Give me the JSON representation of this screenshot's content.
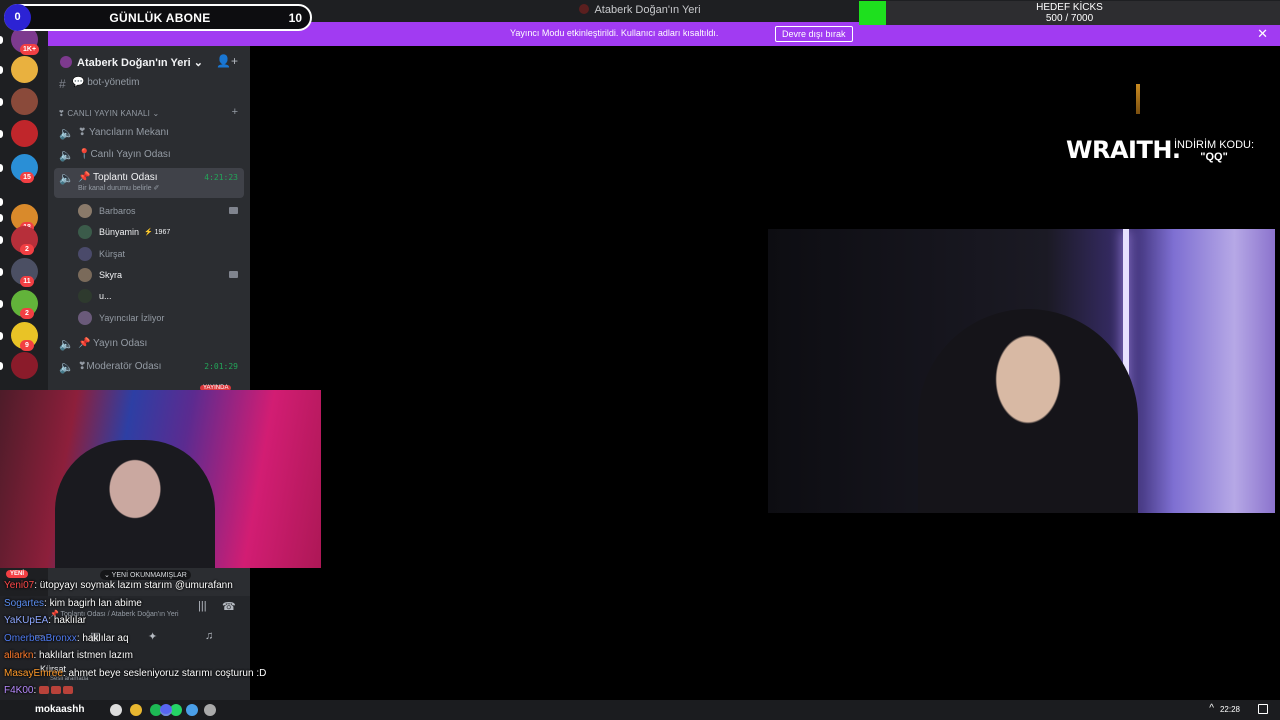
{
  "overlay": {
    "sub_counter": {
      "left_count": "0",
      "label": "GÜNLÜK ABONE",
      "right_count": "10"
    },
    "kicks_goal": {
      "title": "HEDEF KİCKS",
      "progress_text": "500 / 7000",
      "progress": 0.0714,
      "fill_color": "#1ee01e"
    },
    "sponsor": {
      "logo": "WRAITH.",
      "code_label": "İNDİRİM KODU:",
      "code": "\"QQ\""
    }
  },
  "window": {
    "title": "Ataberk Doğan'ın Yeri"
  },
  "banner": {
    "message": "Yayıncı Modu etkinleştirildi. Kullanıcı adları kısaltıldı.",
    "button": "Devre dışı bırak",
    "close": "✕",
    "color": "#a13bf2"
  },
  "rail": {
    "servers": [
      {
        "badge": "1K+",
        "color": "#7d3a8e"
      },
      {
        "badge": "",
        "color": "#e9b13f"
      },
      {
        "badge": "",
        "color": "#8a4a3a"
      },
      {
        "badge": "",
        "color": "#c0262b"
      },
      {
        "badge": "15",
        "color": "#2a8fd6"
      },
      {
        "badge": "",
        "color": "#3a3c45"
      },
      {
        "badge": "18",
        "color": "#d98a2b"
      },
      {
        "badge": "2",
        "color": "#b72f3a"
      },
      {
        "badge": "11",
        "color": "#4b4f63"
      },
      {
        "badge": "2",
        "color": "#62b33a"
      },
      {
        "badge": "9",
        "color": "#e9c326"
      },
      {
        "badge": "",
        "color": "#8a1b2a"
      }
    ]
  },
  "sidebar": {
    "server_name": "Ataberk Doğan'ın Yeri",
    "server_chevron": "⌄",
    "channels_top": [
      {
        "name": "💬 bot-yönetim",
        "icon": "#"
      }
    ],
    "category": {
      "name": "❣ CANLI YAYIN KANALI ⌄",
      "add": "+"
    },
    "voice_channels": [
      {
        "name": "❣ Yancıların Mekanı"
      },
      {
        "name": "📍Canlı Yayın Odası"
      }
    ],
    "active_channel": {
      "name": "📌 Toplantı Odası",
      "time": "4:21:23",
      "status": "Bir kanal durumu belirle ✐"
    },
    "members": [
      {
        "name": "Barbaros",
        "camera": true,
        "extra": ""
      },
      {
        "name": "Bünyamin",
        "camera": false,
        "extra": "⚡ 1967"
      },
      {
        "name": "Kürşat",
        "camera": false,
        "extra": ""
      },
      {
        "name": "Skyra",
        "camera": true,
        "extra": ""
      },
      {
        "name": "u...",
        "camera": false,
        "extra": ""
      },
      {
        "name": "Yayıncılar İzliyor",
        "camera": false,
        "extra": ""
      }
    ],
    "more_channels": [
      {
        "name": "📌 Yayın Odası",
        "time": ""
      },
      {
        "name": "❣Moderatör Odası",
        "time": "2:01:29"
      }
    ],
    "live_badge": "YAYINDA"
  },
  "stream_overlay": {
    "new_tag": "YENİ",
    "unread": "⌄ YENİ OKUNMAMIŞLAR"
  },
  "voice_panel": {
    "channel": "📌 Toplantı Odası / Ataberk Doğan'ın Yeri",
    "user": "Kürşat",
    "status": "Sesli aramada"
  },
  "chat": {
    "messages": [
      {
        "user": "Yeni07",
        "color": "#ff4a4a",
        "text": ": ütopyayı soymak lazım starım @umurafann"
      },
      {
        "user": "Sogartes",
        "color": "#5b8def",
        "text": ": kim bagirh lan abime"
      },
      {
        "user": "YaKUpEA",
        "color": "#8fa8ff",
        "text": ": haklılar"
      },
      {
        "user": "OmerbeaBronxx",
        "color": "#4f7bf0",
        "text": ": haklılar aq"
      },
      {
        "user": "aliarkn",
        "color": "#ff7a2a",
        "text": ": haklılart istmen lazım"
      },
      {
        "user": "MasayEmree",
        "color": "#ff9a2a",
        "text": ": ahmet beye sesleniyoruz starımı coşturun :D"
      },
      {
        "user": "F4K00",
        "color": "#b88aff",
        "text": ":"
      }
    ]
  },
  "taskbar": {
    "user": "mokaashh",
    "time": "22:28",
    "tray_arrow": "^",
    "icons": [
      {
        "name": "chrome-icon",
        "color": "#e8b730"
      },
      {
        "name": "spotify-icon",
        "color": "#1db954"
      },
      {
        "name": "whatsapp-icon",
        "color": "#25d366"
      },
      {
        "name": "obs-icon",
        "color": "#ddd"
      },
      {
        "name": "discord-icon",
        "color": "#5865f2"
      },
      {
        "name": "photos-icon",
        "color": "#4a9fe8"
      },
      {
        "name": "settings-icon",
        "color": "#aaa"
      }
    ]
  }
}
